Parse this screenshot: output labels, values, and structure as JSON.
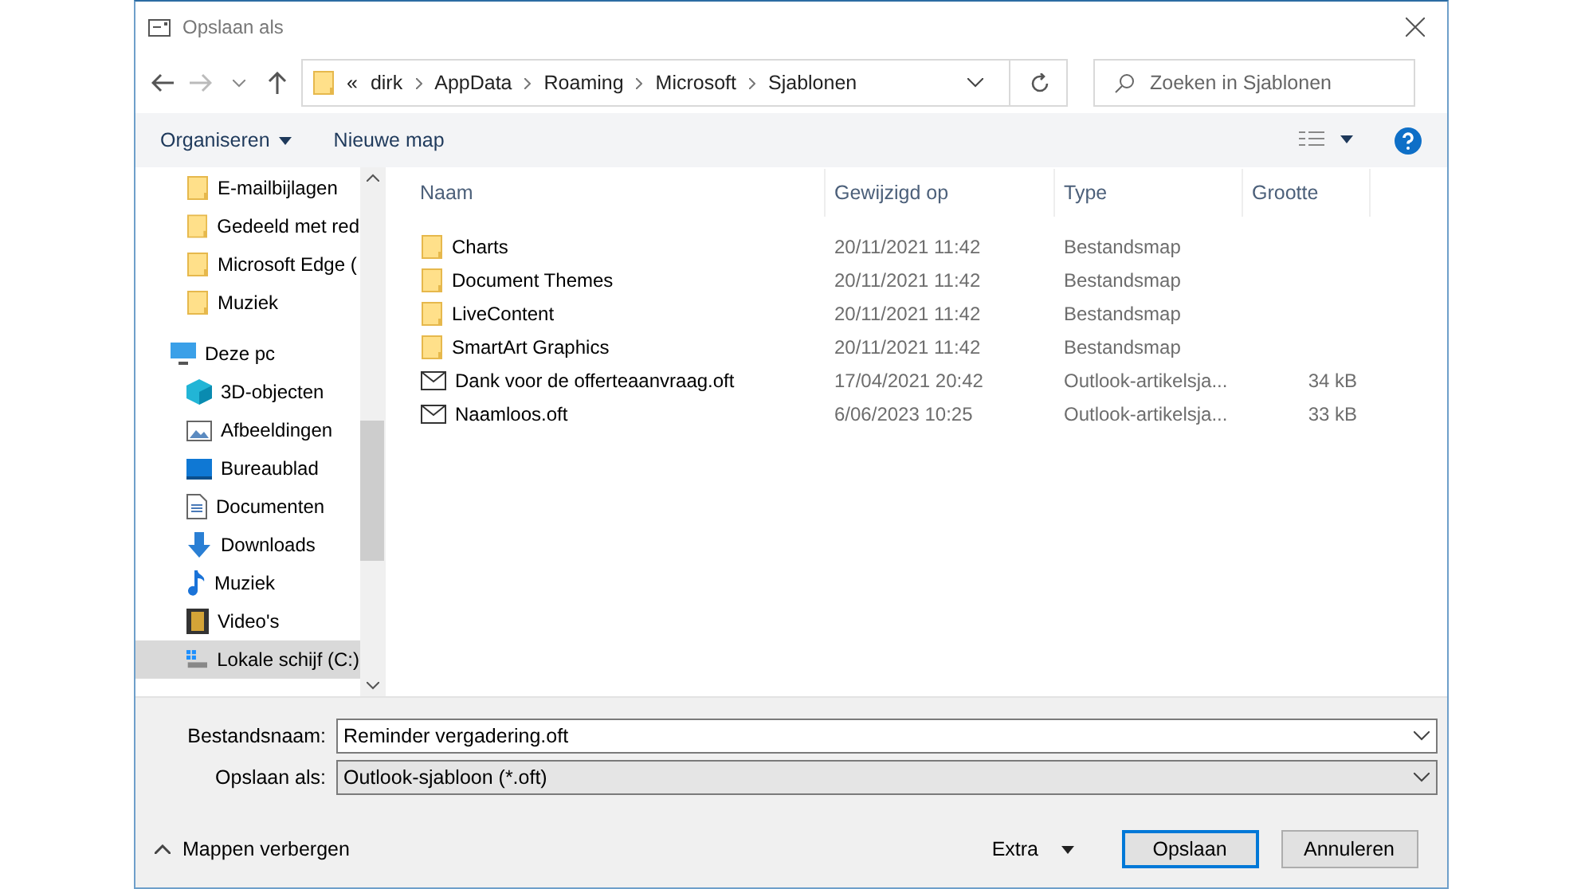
{
  "window": {
    "title": "Opslaan als"
  },
  "nav": {
    "breadcrumb_overflow": "«",
    "path": [
      "dirk",
      "AppData",
      "Roaming",
      "Microsoft",
      "Sjablonen"
    ],
    "search_placeholder": "Zoeken in Sjablonen"
  },
  "toolbar": {
    "organize": "Organiseren",
    "new_folder": "Nieuwe map"
  },
  "sidebar": {
    "continued_children": [
      {
        "label": "E-mailbijlagen",
        "kind": "folder",
        "selected": false
      },
      {
        "label": "Gedeeld met red",
        "kind": "folder",
        "selected": false
      },
      {
        "label": "Microsoft Edge (",
        "kind": "folder",
        "selected": false
      },
      {
        "label": "Muziek",
        "kind": "folder",
        "selected": false
      }
    ],
    "items": [
      {
        "label": "Deze pc",
        "kind": "pc",
        "selected": false,
        "children": [
          {
            "label": "3D-objecten",
            "kind": "cube",
            "selected": false
          },
          {
            "label": "Afbeeldingen",
            "kind": "pictures",
            "selected": false
          },
          {
            "label": "Bureaublad",
            "kind": "desktop",
            "selected": false
          },
          {
            "label": "Documenten",
            "kind": "documents",
            "selected": false
          },
          {
            "label": "Downloads",
            "kind": "downloads",
            "selected": false
          },
          {
            "label": "Muziek",
            "kind": "music",
            "selected": false
          },
          {
            "label": "Video's",
            "kind": "video",
            "selected": false
          },
          {
            "label": "Lokale schijf (C:)",
            "kind": "drive",
            "selected": true
          }
        ]
      }
    ]
  },
  "table": {
    "columns": [
      "Naam",
      "Gewijzigd op",
      "Type",
      "Grootte"
    ],
    "rows": [
      {
        "kind": "folder",
        "name": "Charts",
        "modified": "20/11/2021 11:42",
        "type": "Bestandsmap"
      },
      {
        "kind": "folder",
        "name": "Document Themes",
        "modified": "20/11/2021 11:42",
        "type": "Bestandsmap"
      },
      {
        "kind": "folder",
        "name": "LiveContent",
        "modified": "20/11/2021 11:42",
        "type": "Bestandsmap"
      },
      {
        "kind": "folder",
        "name": "SmartArt Graphics",
        "modified": "20/11/2021 11:42",
        "type": "Bestandsmap"
      },
      {
        "kind": "mail",
        "name": "Dank voor de offerteaanvraag.oft",
        "modified": "17/04/2021 20:42",
        "type": "Outlook-artikelsja...",
        "size": "34 kB"
      },
      {
        "kind": "mail",
        "name": "Naamloos.oft",
        "modified": "6/06/2023 10:25",
        "type": "Outlook-artikelsja...",
        "size": "33 kB"
      }
    ]
  },
  "form": {
    "filename_label": "Bestandsnaam:",
    "filename": "Reminder vergadering.oft",
    "type_label": "Opslaan als:",
    "type": "Outlook-sjabloon (*.oft)"
  },
  "footer": {
    "hide_folders": "Mappen verbergen",
    "extra": "Extra",
    "save": "Opslaan",
    "cancel": "Annuleren"
  }
}
